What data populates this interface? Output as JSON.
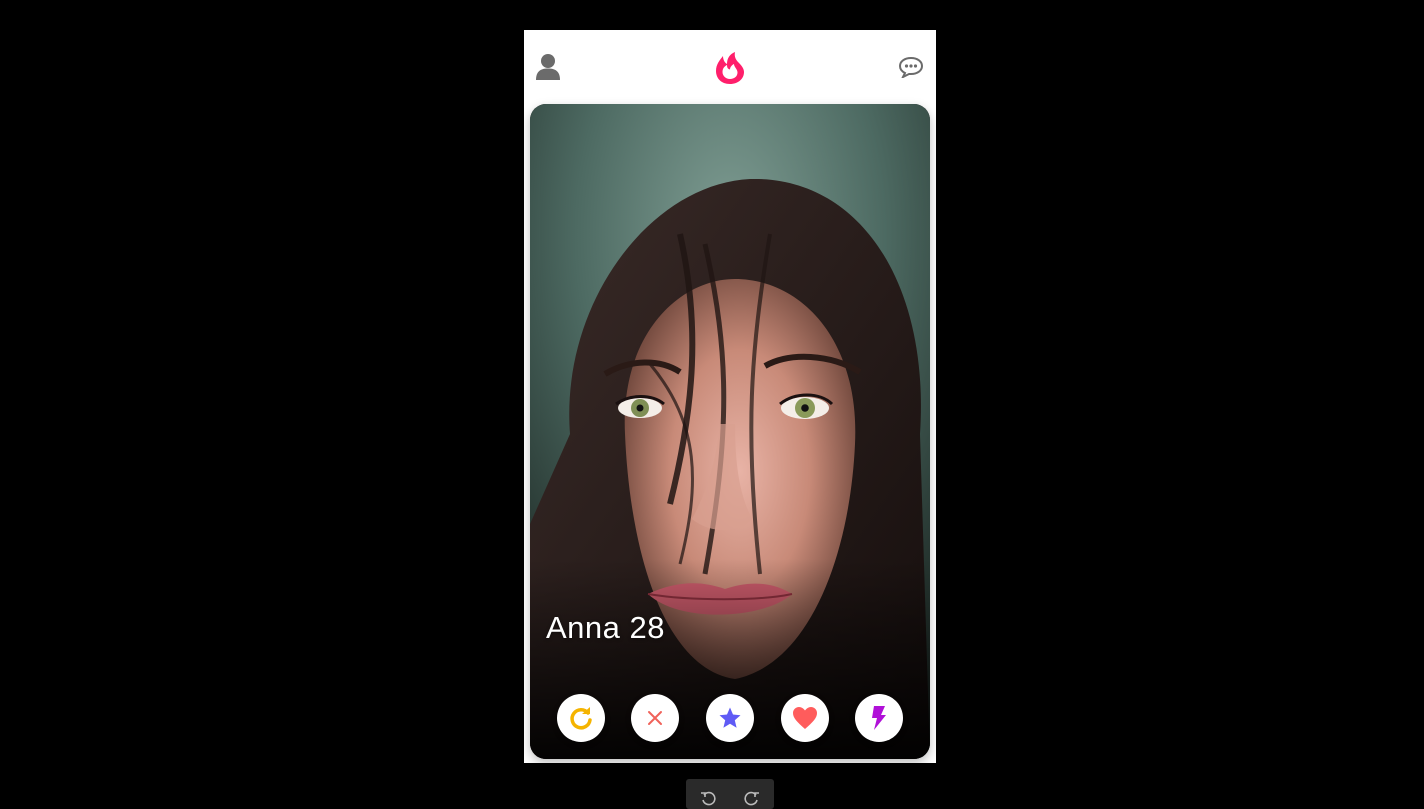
{
  "header": {
    "profile_icon": "person-icon",
    "logo_icon": "flame-logo-icon",
    "chat_icon": "chat-bubble-icon",
    "brand_color": "#ff1f6b",
    "icon_color": "#6b6b6b"
  },
  "card": {
    "name_age": "Anna 28",
    "photo": "portrait-photo"
  },
  "actions": {
    "rewind": {
      "icon": "rewind-icon",
      "color": "#f5b400"
    },
    "nope": {
      "icon": "close-icon",
      "color": "#f0625a"
    },
    "super_like": {
      "icon": "star-icon",
      "color": "#5f5bf5"
    },
    "like": {
      "icon": "heart-icon",
      "color": "#ff5c5c"
    },
    "boost": {
      "icon": "lightning-icon",
      "color": "#b010d8"
    }
  },
  "viewer_controls": {
    "rotate_left_icon": "rotate-left-icon",
    "rotate_right_icon": "rotate-right-icon"
  }
}
